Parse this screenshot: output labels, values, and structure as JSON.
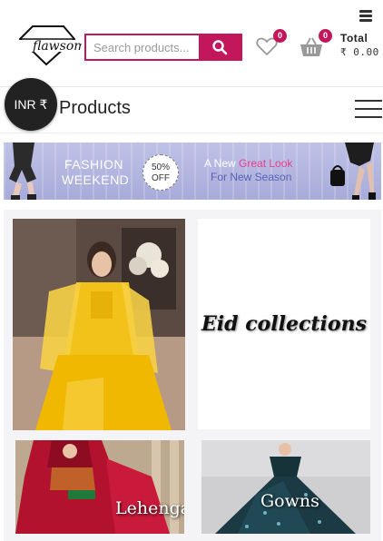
{
  "header": {
    "logo_text": "flawsome",
    "search_placeholder": "Search products...",
    "wishlist_count": "0",
    "cart_count": "0",
    "total_label": "Total",
    "total_amount": "₹ 0.00"
  },
  "nav": {
    "currency": "INR ₹",
    "title": "Products"
  },
  "banner": {
    "line1": "FASHION",
    "line2": "WEEKEND",
    "discount_line1": "50%",
    "discount_line2": "OFF",
    "tagline_prefix": "A New",
    "tagline_highlight": "Great Look",
    "tagline_line2": "For New Season"
  },
  "collections": {
    "eid": "Eid collections",
    "lehenga": "Lehenga",
    "gowns": "Gowns"
  },
  "colors": {
    "accent": "#c2185b",
    "banner_bg": "#b3b6e0"
  }
}
